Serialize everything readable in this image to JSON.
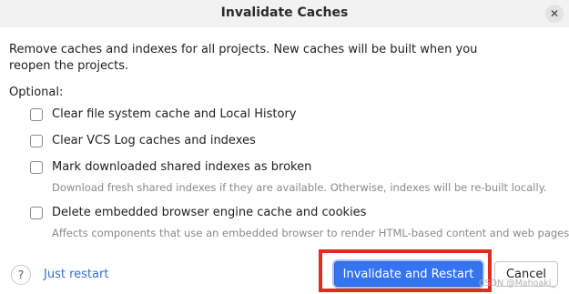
{
  "dialog": {
    "title": "Invalidate Caches",
    "close_icon": "close-icon"
  },
  "description": "Remove caches and indexes for all projects. New caches will be built when you reopen the projects.",
  "optional_label": "Optional:",
  "options": [
    {
      "label": "Clear file system cache and Local History",
      "checked": false,
      "hint": ""
    },
    {
      "label": "Clear VCS Log caches and indexes",
      "checked": false,
      "hint": ""
    },
    {
      "label": "Mark downloaded shared indexes as broken",
      "checked": false,
      "hint": "Download fresh shared indexes if they are available. Otherwise, indexes will be re-built locally."
    },
    {
      "label": "Delete embedded browser engine cache and cookies",
      "checked": false,
      "hint": "Affects components that use an embedded browser to render HTML-based content and web pages."
    }
  ],
  "footer": {
    "help_glyph": "?",
    "just_restart": "Just restart",
    "invalidate_restart": "Invalidate and Restart",
    "cancel": "Cancel"
  },
  "watermark": "CSDN @Mahoaki_",
  "colors": {
    "accent": "#3574f0",
    "highlight": "#e52b1f",
    "link": "#2f6fd6",
    "hint": "#8a8a8a"
  }
}
